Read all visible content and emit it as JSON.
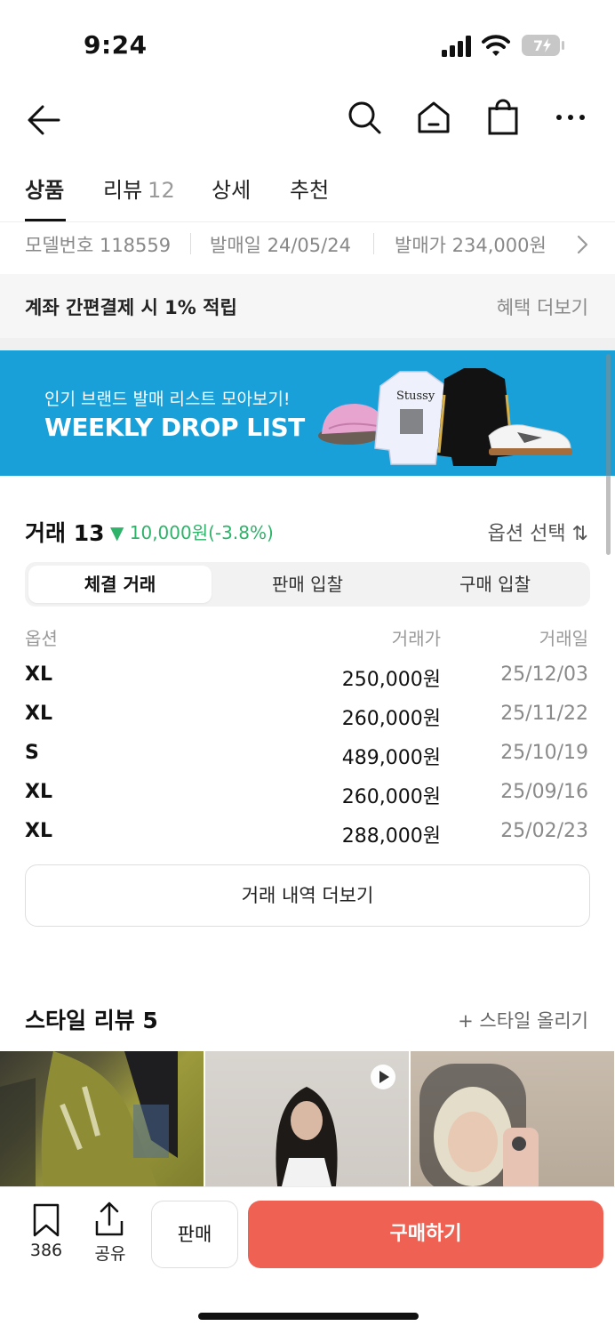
{
  "status_bar": {
    "time": "9:24",
    "battery": "7"
  },
  "tabs": [
    {
      "label": "상품",
      "count": ""
    },
    {
      "label": "리뷰",
      "count": "12"
    },
    {
      "label": "상세",
      "count": ""
    },
    {
      "label": "추천",
      "count": ""
    }
  ],
  "info": {
    "model": "모델번호 118559",
    "release_date": "발매일 24/05/24",
    "release_price": "발매가 234,000원"
  },
  "benefit": {
    "text": "계좌 간편결제 시 1% 적립",
    "more": "혜택 더보기"
  },
  "banner": {
    "subtitle": "인기 브랜드 발매 리스트 모아보기!",
    "title": "WEEKLY DROP LIST",
    "bg_color": "#1aa0d8"
  },
  "trades": {
    "title": "거래 13",
    "change": "▼ 10,000원(-3.8%)",
    "option_select": "옵션 선택 ⇅",
    "segments": [
      "체결 거래",
      "판매 입찰",
      "구매 입찰"
    ],
    "headers": {
      "option": "옵션",
      "price": "거래가",
      "date": "거래일"
    },
    "rows": [
      {
        "option": "XL",
        "price": "250,000원",
        "date": "25/12/03"
      },
      {
        "option": "XL",
        "price": "260,000원",
        "date": "25/11/22"
      },
      {
        "option": "S",
        "price": "489,000원",
        "date": "25/10/19"
      },
      {
        "option": "XL",
        "price": "260,000원",
        "date": "25/09/16"
      },
      {
        "option": "XL",
        "price": "288,000원",
        "date": "25/02/23"
      }
    ],
    "more": "거래 내역 더보기",
    "change_color": "#2fb36a"
  },
  "style_reviews": {
    "title": "스타일 리뷰 5",
    "upload": "+ 스타일 올리기"
  },
  "bottom": {
    "bookmark_count": "386",
    "share_label": "공유",
    "sell_label": "판매",
    "buy_label": "구매하기",
    "buy_color": "#ef6253"
  }
}
